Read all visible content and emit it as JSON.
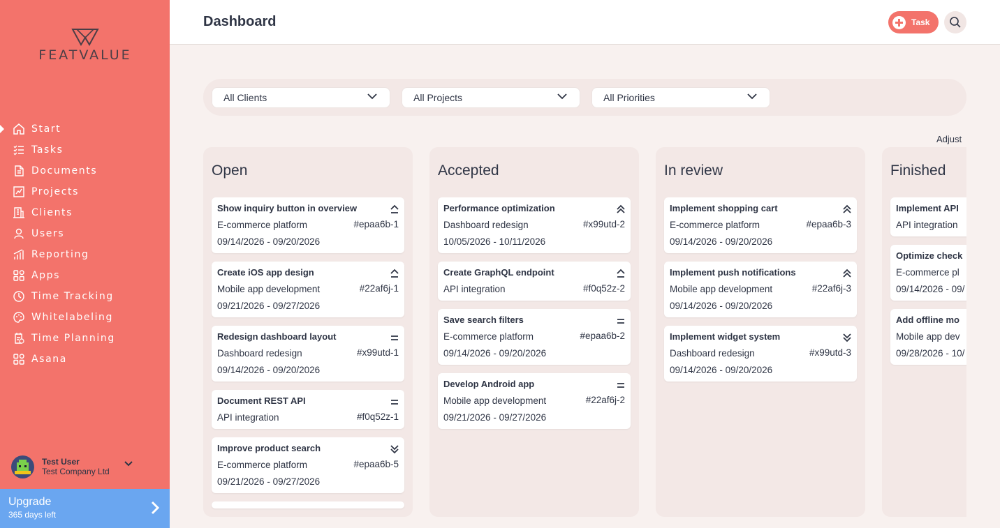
{
  "brand": {
    "name": "FEATVALUE"
  },
  "colors": {
    "brand": "#f3736b",
    "upgrade": "#6aa6f0",
    "text": "#2f3545"
  },
  "sidebar": {
    "items": [
      {
        "label": "Start",
        "icon": "home-icon"
      },
      {
        "label": "Tasks",
        "icon": "tasks-icon"
      },
      {
        "label": "Documents",
        "icon": "documents-icon"
      },
      {
        "label": "Projects",
        "icon": "projects-icon"
      },
      {
        "label": "Clients",
        "icon": "clients-icon"
      },
      {
        "label": "Users",
        "icon": "users-icon"
      },
      {
        "label": "Reporting",
        "icon": "reporting-icon"
      },
      {
        "label": "Apps",
        "icon": "apps-icon"
      },
      {
        "label": "Time Tracking",
        "icon": "time-tracking-icon"
      },
      {
        "label": "Whitelabeling",
        "icon": "whitelabeling-icon"
      },
      {
        "label": "Time Planning",
        "icon": "time-planning-icon"
      },
      {
        "label": "Asana",
        "icon": "asana-icon"
      }
    ],
    "active": "Start"
  },
  "user": {
    "name": "Test User",
    "company": "Test Company Ltd"
  },
  "upgrade": {
    "title": "Upgrade",
    "subtitle": "365 days left"
  },
  "header": {
    "title": "Dashboard",
    "task_button": "Task"
  },
  "filters": {
    "clients": "All Clients",
    "projects": "All Projects",
    "priorities": "All Priorities"
  },
  "adjust_label": "Adjust",
  "columns": [
    {
      "title": "Open",
      "cards": [
        {
          "title": "Show inquiry button in overview",
          "project": "E-commerce platform",
          "id": "#epaa6b-1",
          "dates": "09/14/2026 - 09/20/2026",
          "priority": "high"
        },
        {
          "title": "Create iOS app design",
          "project": "Mobile app development",
          "id": "#22af6j-1",
          "dates": "09/21/2026 - 09/27/2026",
          "priority": "high"
        },
        {
          "title": "Redesign dashboard layout",
          "project": "Dashboard redesign",
          "id": "#x99utd-1",
          "dates": "09/14/2026 - 09/20/2026",
          "priority": "medium"
        },
        {
          "title": "Document REST API",
          "project": "API integration",
          "id": "#f0q52z-1",
          "dates": "",
          "priority": "medium"
        },
        {
          "title": "Improve product search",
          "project": "E-commerce platform",
          "id": "#epaa6b-5",
          "dates": "09/21/2026 - 09/27/2026",
          "priority": "lowest"
        }
      ]
    },
    {
      "title": "Accepted",
      "cards": [
        {
          "title": "Performance optimization",
          "project": "Dashboard redesign",
          "id": "#x99utd-2",
          "dates": "10/05/2026 - 10/11/2026",
          "priority": "highest"
        },
        {
          "title": "Create GraphQL endpoint",
          "project": "API integration",
          "id": "#f0q52z-2",
          "dates": "",
          "priority": "high"
        },
        {
          "title": "Save search filters",
          "project": "E-commerce platform",
          "id": "#epaa6b-2",
          "dates": "09/14/2026 - 09/20/2026",
          "priority": "medium"
        },
        {
          "title": "Develop Android app",
          "project": "Mobile app development",
          "id": "#22af6j-2",
          "dates": "09/21/2026 - 09/27/2026",
          "priority": "medium"
        }
      ]
    },
    {
      "title": "In review",
      "cards": [
        {
          "title": "Implement shopping cart",
          "project": "E-commerce platform",
          "id": "#epaa6b-3",
          "dates": "09/14/2026 - 09/20/2026",
          "priority": "highest"
        },
        {
          "title": "Implement push notifications",
          "project": "Mobile app development",
          "id": "#22af6j-3",
          "dates": "09/14/2026 - 09/20/2026",
          "priority": "highest"
        },
        {
          "title": "Implement widget system",
          "project": "Dashboard redesign",
          "id": "#x99utd-3",
          "dates": "09/14/2026 - 09/20/2026",
          "priority": "lowest"
        }
      ]
    },
    {
      "title": "Finished",
      "cards": [
        {
          "title": "Implement API",
          "project": "API integration",
          "id": "",
          "dates": "",
          "priority": ""
        },
        {
          "title": "Optimize check",
          "project": "E-commerce pl",
          "id": "",
          "dates": "09/14/2026 - 09/",
          "priority": ""
        },
        {
          "title": "Add offline mo",
          "project": "Mobile app dev",
          "id": "",
          "dates": "09/28/2026 - 10/",
          "priority": ""
        }
      ]
    }
  ]
}
